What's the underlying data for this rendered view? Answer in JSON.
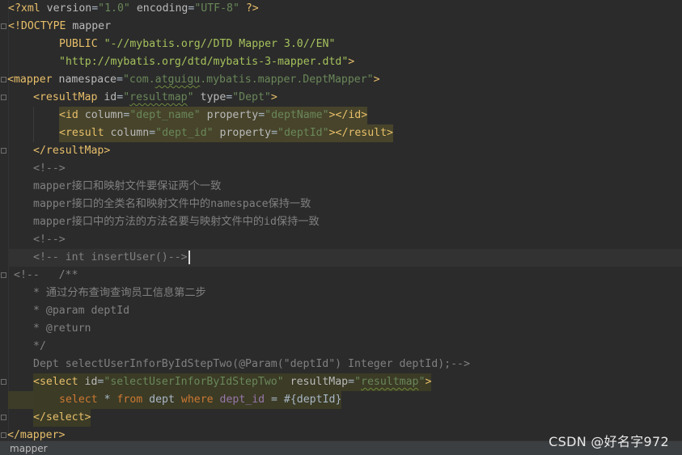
{
  "editor": {
    "l1": {
      "t1": "<?xml ",
      "a1": "version",
      "t2": "=",
      "s1": "\"1.0\"",
      "t3": " ",
      "a2": "encoding",
      "t4": "=",
      "s2": "\"UTF-8\"",
      "t5": " ?>"
    },
    "l2": {
      "t1": "<!DOCTYPE ",
      "t2": "mapper"
    },
    "l3": {
      "t1": "PUBLIC ",
      "s1": "\"-//mybatis.org//DTD Mapper 3.0//EN\""
    },
    "l4": {
      "s1": "\"http://mybatis.org/dtd/mybatis-3-mapper.dtd\"",
      "t1": ">"
    },
    "l5": {
      "t1": "<mapper ",
      "a1": "namespace",
      "t2": "=",
      "s1a": "\"com.",
      "s1b": "atguigu",
      "s1c": ".mybatis.mapper.DeptMapper\"",
      "t3": ">"
    },
    "l6": {
      "t1": "<resultMap ",
      "a1": "id",
      "t2": "=",
      "s1a": "\"",
      "s1b": "resultmap",
      "s1c": "\"",
      "t3": " ",
      "a2": "type",
      "t4": "=",
      "s2": "\"Dept\"",
      "t5": ">"
    },
    "l7": {
      "t1": "<id ",
      "a1": "column",
      "t2": "=",
      "s1": "\"dept_name\"",
      "t3": " ",
      "a2": "property",
      "t4": "=",
      "s2": "\"deptName\"",
      "t5": "></id>"
    },
    "l8": {
      "t1": "<result ",
      "a1": "column",
      "t2": "=",
      "s1": "\"dept_id\"",
      "t3": " ",
      "a2": "property",
      "t4": "=",
      "s2": "\"deptId\"",
      "t5": "></result>"
    },
    "l9": {
      "t1": "</resultMap>"
    },
    "l10": {
      "c1": "<!-->"
    },
    "l11": {
      "c1": "mapper接口和映射文件要保证两个一致"
    },
    "l12": {
      "c1": "mapper接口的全类名和映射文件中的namespace保持一致"
    },
    "l13": {
      "c1": "mapper接口中的方法的方法名要与映射文件中的id保持一致"
    },
    "l14": {
      "c1": "<!-->"
    },
    "l15": {
      "c1": "<!-- int insertUser()-->"
    },
    "l16": {
      "c1": "<!--   /**"
    },
    "l17": {
      "c1": "* 通过分布查询查询员工信息第二步"
    },
    "l18": {
      "c1": "* @param deptId"
    },
    "l19": {
      "c1": "* @return"
    },
    "l20": {
      "c1": "*/"
    },
    "l21": {
      "c1": "Dept selectUserInforByIdStepTwo(@Param(\"deptId\") Integer deptId);-->"
    },
    "l22": {
      "t1": "<select ",
      "a1": "id",
      "t2": "=",
      "s1": "\"selectUserInforByIdStepTwo\"",
      "t3": " ",
      "a2": "resultMap",
      "t4": "=",
      "s2a": "\"",
      "s2b": "resultmap",
      "s2c": "\"",
      "t5": ">"
    },
    "l23": {
      "k1": "select",
      "p1": " * ",
      "k2": "from",
      "p2": " dept ",
      "k3": "where",
      "p3": " ",
      "i1": "dept_id",
      "p4": " = #{deptId}"
    },
    "l24": {
      "t1": "</select>"
    },
    "l25": {
      "t1": "</mapper>"
    }
  },
  "statusbar": {
    "breadcrumb": "mapper"
  },
  "watermark": "CSDN @好名字972",
  "colors": {
    "background": "#2b2b2b",
    "tag": "#e8bf6a",
    "string": "#6a8759",
    "comment": "#808080",
    "keyword": "#cc7832"
  }
}
